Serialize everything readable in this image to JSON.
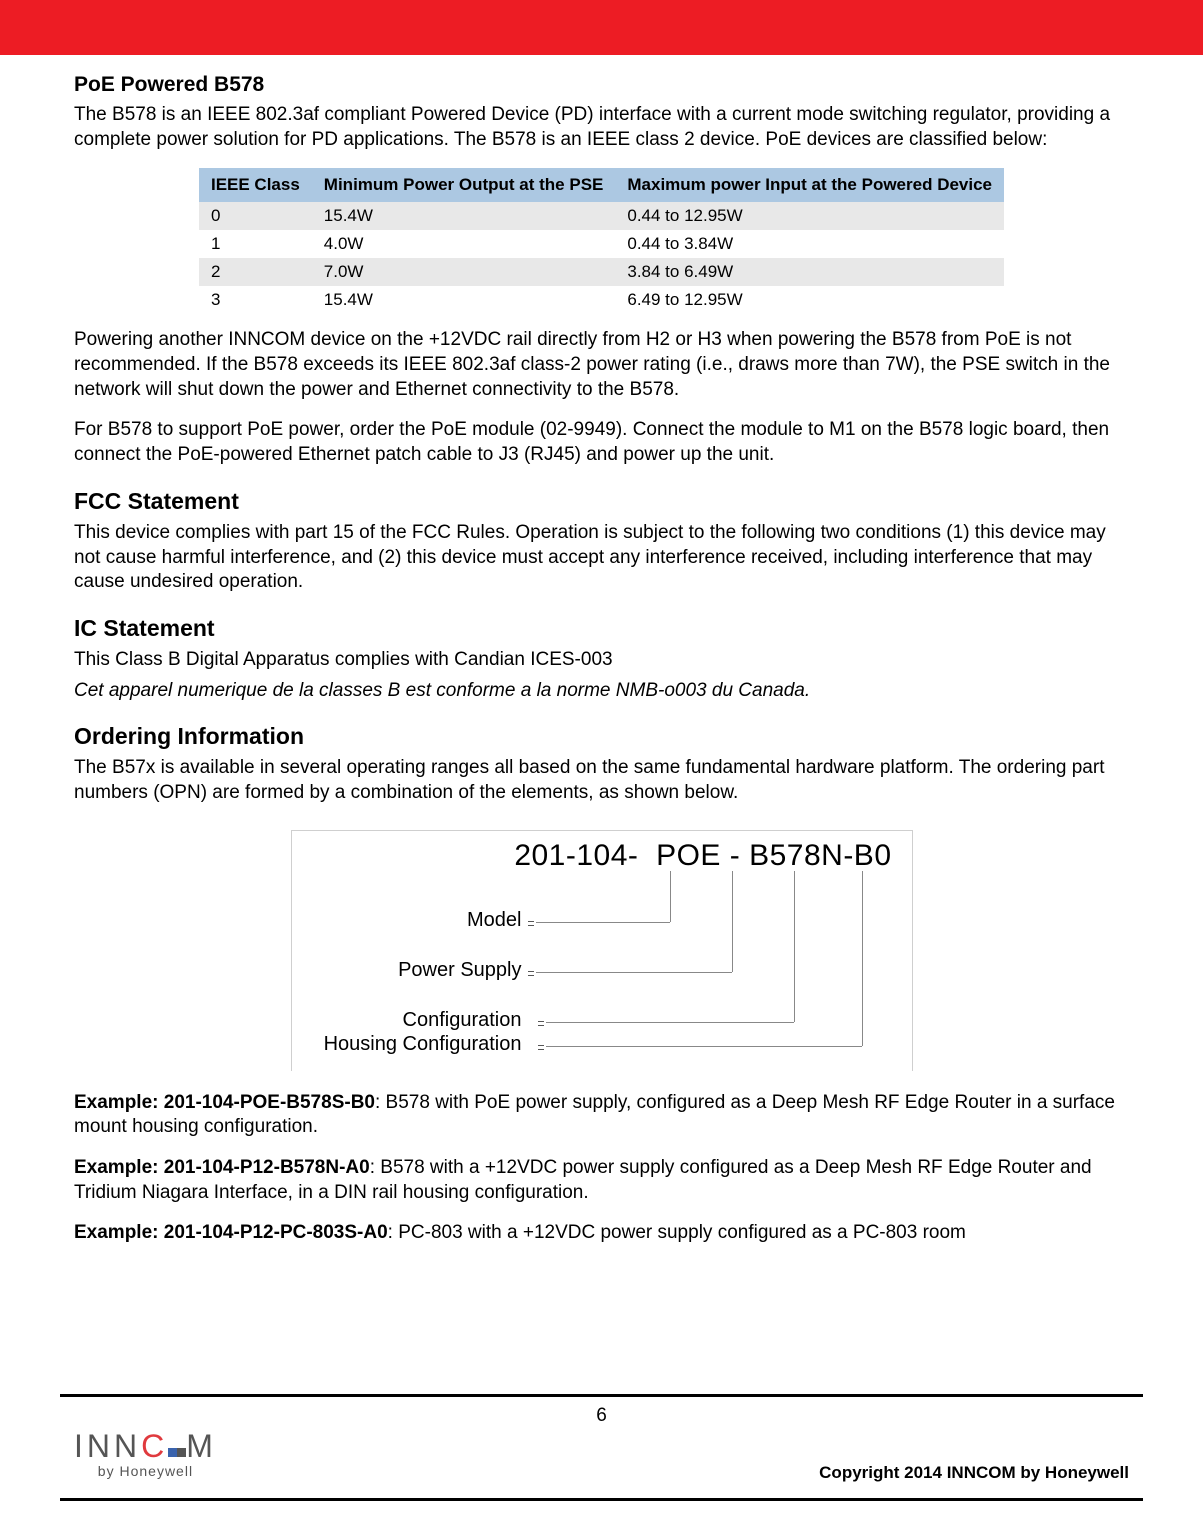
{
  "section1": {
    "heading": "PoE Powered B578",
    "para1": "The B578 is an IEEE 802.3af compliant Powered Device (PD) interface with a current mode switching regulator, providing a complete power solution for PD applications. The B578 is an IEEE class 2 device. PoE devices are classified below:",
    "table": {
      "headers": [
        "IEEE Class",
        "Minimum Power Output at the PSE",
        "Maximum power Input at the Powered Device"
      ],
      "rows": [
        [
          "0",
          "15.4W",
          "0.44 to 12.95W"
        ],
        [
          "1",
          "4.0W",
          "0.44 to 3.84W"
        ],
        [
          "2",
          "7.0W",
          "3.84 to 6.49W"
        ],
        [
          "3",
          "15.4W",
          "6.49 to 12.95W"
        ]
      ]
    },
    "para2": "Powering another INNCOM device on the +12VDC rail directly from H2 or H3 when powering the B578 from PoE is not recommended. If the B578 exceeds its IEEE 802.3af class-2 power rating (i.e., draws more than 7W), the PSE switch in the network will shut down the power and Ethernet connectivity to the B578.",
    "para3": "For B578 to support PoE power, order the PoE module (02-9949). Connect the module to M1 on the B578 logic board, then connect the PoE-powered Ethernet patch cable to J3 (RJ45) and power up the unit."
  },
  "fcc": {
    "heading": "FCC Statement",
    "para": "This device complies with part 15 of the FCC Rules. Operation is subject to the following two conditions (1) this device may not cause harmful interference, and (2) this device must accept any interference received, including interference that may cause undesired operation."
  },
  "ic": {
    "heading": "IC Statement",
    "line1": "This Class B Digital Apparatus complies with Candian ICES-003",
    "line2": "Cet apparel numerique de la classes B est conforme a la norme NMB-o003 du Canada."
  },
  "ordering": {
    "heading": "Ordering Information",
    "para": "The B57x is available in several operating ranges all based on the same fundamental hardware platform. The ordering part numbers (OPN) are formed by a combination of the elements, as shown below.",
    "diagram": {
      "opn": "201-104-  POE - B578N-B0",
      "labels": {
        "model": "Model",
        "power": "Power Supply",
        "config": "Configuration",
        "housing": "Housing Configuration"
      }
    },
    "ex1_bold": "Example: 201-104-POE-B578S-B0",
    "ex1_rest": ": B578 with PoE power supply, configured as a Deep Mesh RF Edge Router in a surface mount housing configuration.",
    "ex2_bold": "Example: 201-104-P12-B578N-A0",
    "ex2_rest": ": B578 with a +12VDC power supply configured as a Deep Mesh RF Edge Router and Tridium Niagara Interface, in a DIN rail housing configuration.",
    "ex3_bold": "Example: 201-104-P12-PC-803S-A0",
    "ex3_rest": ": PC-803 with a +12VDC power supply configured as a PC-803 room"
  },
  "footer": {
    "page": "6",
    "copyright": "Copyright 2014 INNCOM by Honeywell",
    "logo_sub": "by Honeywell"
  }
}
